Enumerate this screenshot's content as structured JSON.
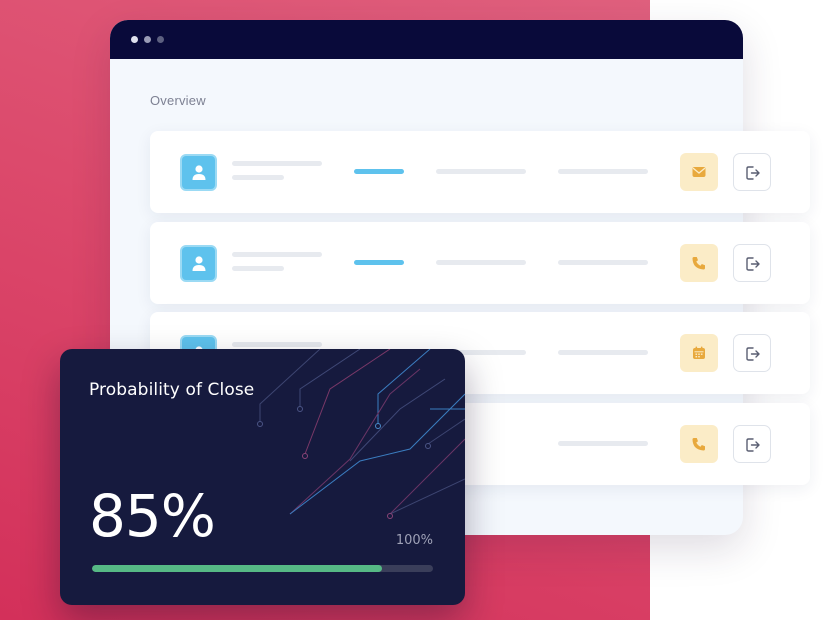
{
  "window": {
    "section_title": "Overview"
  },
  "rows": [
    {
      "action_icon": "mail-icon"
    },
    {
      "action_icon": "phone-icon"
    },
    {
      "action_icon": "calendar-icon"
    },
    {
      "action_icon": "phone-icon"
    }
  ],
  "probability_card": {
    "title": "Probability of Close",
    "value_label": "85%",
    "max_label": "100%",
    "progress_fraction": 0.85
  },
  "colors": {
    "background_gradient": [
      "#e0607e",
      "#d3305a"
    ],
    "titlebar": "#090a3a",
    "accent_blue": "#5ec2ed",
    "action_tile": "#fbecc7",
    "action_icon": "#e8a93d",
    "card_bg": "#161a3e",
    "progress_fill": "#56b985"
  }
}
